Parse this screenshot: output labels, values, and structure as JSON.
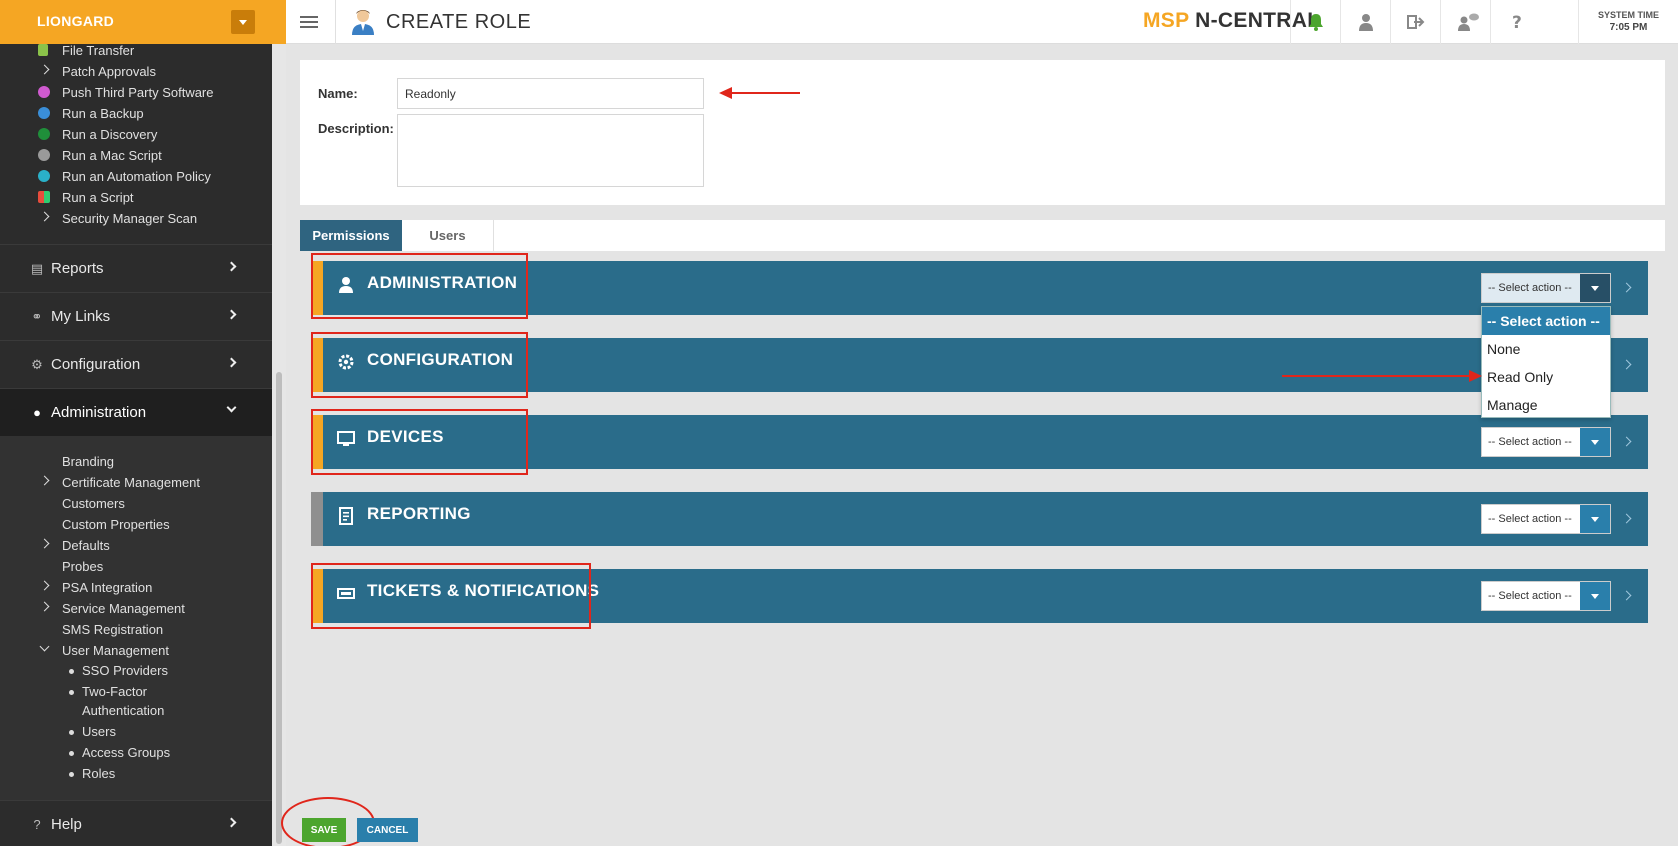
{
  "brand": {
    "name": "LIONGARD"
  },
  "header": {
    "page_title": "CREATE ROLE",
    "product_msp": "MSP",
    "product_name": "N-CENTRAL",
    "system_time_label": "SYSTEM TIME",
    "system_time_value": "7:05 PM",
    "colors": {
      "accent": "#f5a623",
      "bell": "#4ca52e"
    }
  },
  "sidebar": {
    "task_items": [
      {
        "label": "File Transfer",
        "icon": "file-transfer-icon"
      },
      {
        "label": "Patch Approvals",
        "icon": "chevron-right-icon"
      },
      {
        "label": "Push Third Party Software",
        "icon": "push-software-icon"
      },
      {
        "label": "Run a Backup",
        "icon": "backup-gear-icon"
      },
      {
        "label": "Run a Discovery",
        "icon": "discovery-globe-icon"
      },
      {
        "label": "Run a Mac Script",
        "icon": "mac-script-icon"
      },
      {
        "label": "Run an Automation Policy",
        "icon": "automation-policy-icon"
      },
      {
        "label": "Run a Script",
        "icon": "script-windows-icon"
      },
      {
        "label": "Security Manager Scan",
        "icon": "chevron-right-icon"
      }
    ],
    "sections": {
      "reports": "Reports",
      "my_links": "My Links",
      "configuration": "Configuration",
      "administration": "Administration",
      "help": "Help"
    },
    "admin_items": [
      {
        "label": "Branding",
        "expandable": false
      },
      {
        "label": "Certificate Management",
        "expandable": true
      },
      {
        "label": "Customers",
        "expandable": false
      },
      {
        "label": "Custom Properties",
        "expandable": false
      },
      {
        "label": "Defaults",
        "expandable": true
      },
      {
        "label": "Probes",
        "expandable": false
      },
      {
        "label": "PSA Integration",
        "expandable": true
      },
      {
        "label": "Service Management",
        "expandable": true
      },
      {
        "label": "SMS Registration",
        "expandable": false
      },
      {
        "label": "User Management",
        "expandable": true,
        "expanded": true
      }
    ],
    "user_mgmt_items": [
      "SSO Providers",
      "Two-Factor",
      "Authentication",
      "Users",
      "Access Groups",
      "Roles"
    ]
  },
  "form": {
    "name_label": "Name:",
    "name_value": "Readonly",
    "description_label": "Description:",
    "description_value": ""
  },
  "tabs": [
    {
      "label": "Permissions",
      "active": true
    },
    {
      "label": "Users",
      "active": false
    }
  ],
  "permissions": [
    {
      "title": "ADMINISTRATION",
      "icon": "user-icon",
      "select_value": "-- Select action --",
      "open": true
    },
    {
      "title": "CONFIGURATION",
      "icon": "gear-icon",
      "select_value": "-- Select action --"
    },
    {
      "title": "DEVICES",
      "icon": "monitor-icon",
      "select_value": "-- Select action --"
    },
    {
      "title": "REPORTING",
      "icon": "report-icon",
      "select_value": "-- Select action --"
    },
    {
      "title": "TICKETS & NOTIFICATIONS",
      "icon": "ticket-icon",
      "select_value": "-- Select action --"
    }
  ],
  "dropdown": {
    "options": [
      "-- Select action --",
      "None",
      "Read Only",
      "Manage"
    ],
    "selected_index": 0
  },
  "buttons": {
    "save": "SAVE",
    "cancel": "CANCEL"
  }
}
